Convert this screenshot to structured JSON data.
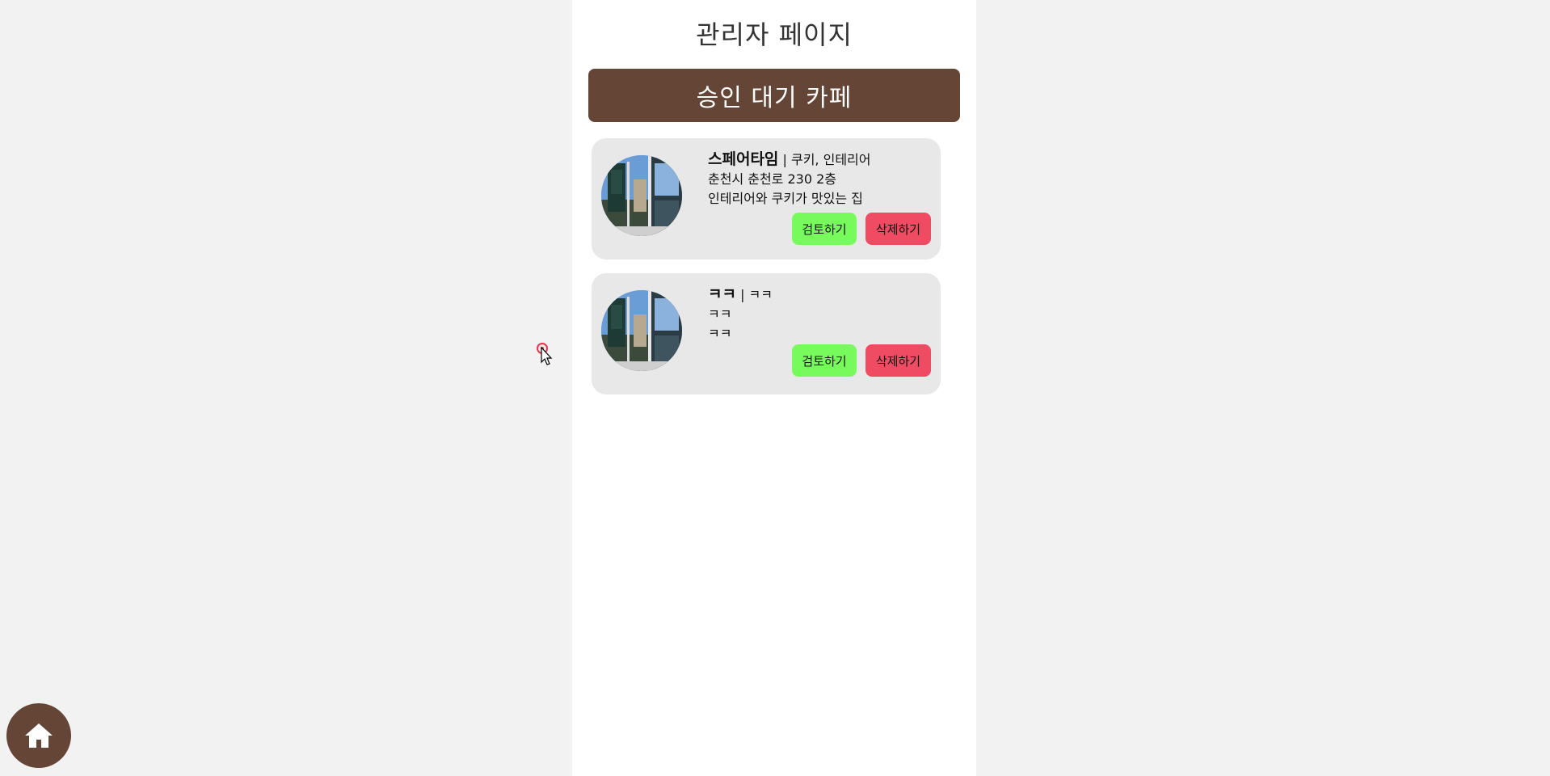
{
  "page": {
    "title": "관리자 페이지",
    "section_title": "승인 대기 카페"
  },
  "cafes": [
    {
      "name": "스페어타임",
      "separator": "|",
      "tags": "쿠키, 인테리어",
      "address": "춘천시 춘천로 230 2층",
      "description": "인테리어와 쿠키가 맛있는 집",
      "review_label": "검토하기",
      "delete_label": "삭제하기"
    },
    {
      "name": "ㅋㅋ",
      "separator": "|",
      "tags": "ㅋㅋ",
      "address": "ㅋㅋ",
      "description": "ㅋㅋ",
      "review_label": "검토하기",
      "delete_label": "삭제하기"
    }
  ],
  "colors": {
    "header_brown": "#654535",
    "card_bg": "#e8e8e8",
    "review_green": "#77fa5c",
    "delete_red": "#ef4b63"
  },
  "icons": {
    "home": "home-icon",
    "cursor": "mouse-pointer-icon"
  }
}
